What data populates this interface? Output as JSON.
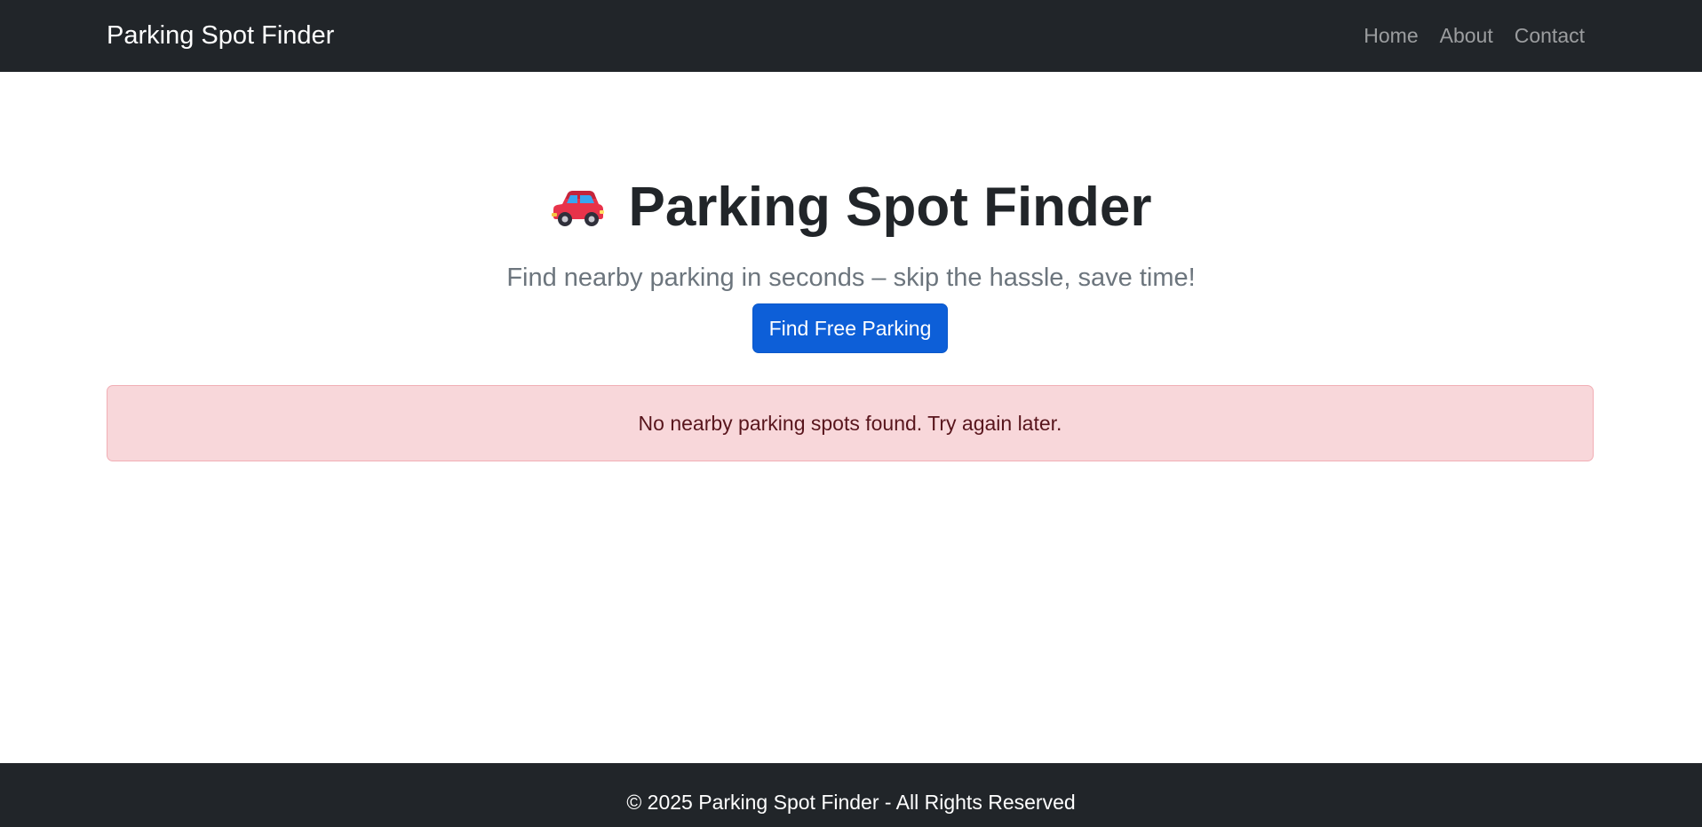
{
  "navbar": {
    "brand": "Parking Spot Finder",
    "links": [
      {
        "label": "Home"
      },
      {
        "label": "About"
      },
      {
        "label": "Contact"
      }
    ]
  },
  "hero": {
    "icon": "car-icon",
    "title": "Parking Spot Finder",
    "subtitle": "Find nearby parking in seconds – skip the hassle, save time!",
    "button_label": "Find Free Parking"
  },
  "alert": {
    "message": "No nearby parking spots found. Try again later."
  },
  "footer": {
    "text": "© 2025 Parking Spot Finder - All Rights Reserved"
  },
  "colors": {
    "navbar_bg": "#212529",
    "primary_button": "#0d5fd8",
    "alert_bg": "#f8d7da",
    "alert_text": "#58151c"
  }
}
